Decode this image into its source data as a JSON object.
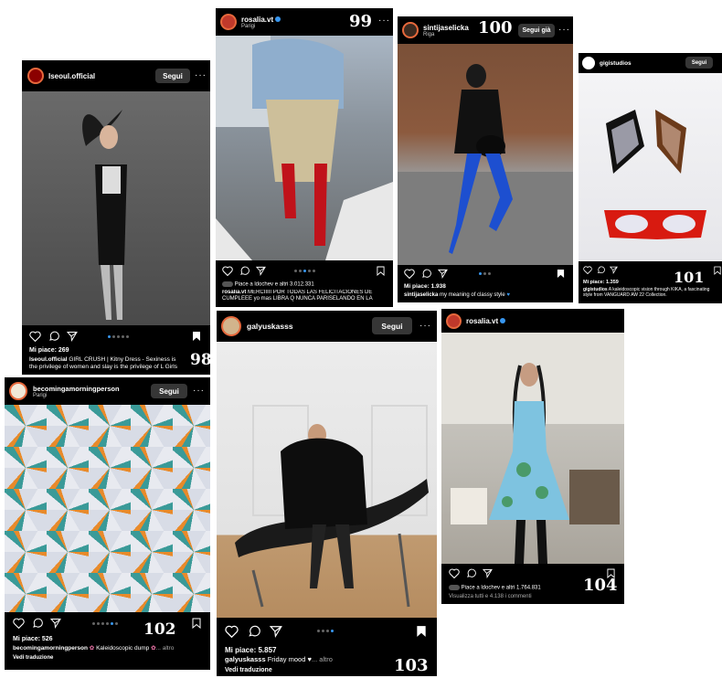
{
  "follow_label": "Segui",
  "following_label": "Segui già",
  "more": "···",
  "posts": [
    {
      "username": "lseoul.official",
      "likes": "Mi piace: 269",
      "caption_user": "lseoul.official",
      "caption": "GIRL CRUSH | Kitny Dress - Sexiness is the privilege of women and slay is the privilege of L Girls",
      "number": "98"
    },
    {
      "username": "rosalia.vt",
      "location": "Parigi",
      "likes": "Piace a ldochev e altri 3.012.331",
      "caption_user": "rosalia.vt",
      "caption": "MERCIIIII POR TODAS LAS FELICITACIONES DE CUMPLEEE yo mas LIBRA Q NUNCA PARISELANDO EN LA CIUDAD DEL AMOR son ext mejores amigas ... altro",
      "number": "99"
    },
    {
      "username": "sintijaselicka",
      "location": "Riga",
      "likes": "Mi piace: 1.938",
      "caption_user": "sintijaselicka",
      "caption": "my meaning of classy style",
      "number": "100"
    },
    {
      "username": "gigistudios",
      "likes": "Mi piace: 1.359",
      "caption_user": "gigistudios",
      "caption": "A kaleidoscopic vision through KIKA, a fascinating style from VANGUARD AW 22 Collection.",
      "number": "101"
    },
    {
      "username": "becomingamorningperson",
      "location": "Parigi",
      "likes": "Mi piace: 526",
      "caption_user": "becomingamorningperson",
      "caption": "Kaleidoscopic dump",
      "more": "... altro",
      "translate": "Vedi traduzione",
      "number": "102"
    },
    {
      "username": "galyuskasss",
      "likes": "Mi piace: 5.857",
      "caption_user": "galyuskasss",
      "caption": "Friday mood",
      "more": "... altro",
      "translate": "Vedi traduzione",
      "number": "103"
    },
    {
      "username": "rosalia.vt",
      "likes": "Piace a ldochev e altri 1.764.831",
      "comments": "Visualizza tutti e 4.138 i commenti",
      "number": "104"
    }
  ],
  "colors": {
    "card": "#000000",
    "follow_button": "#363636",
    "accent": "#3897f0"
  }
}
